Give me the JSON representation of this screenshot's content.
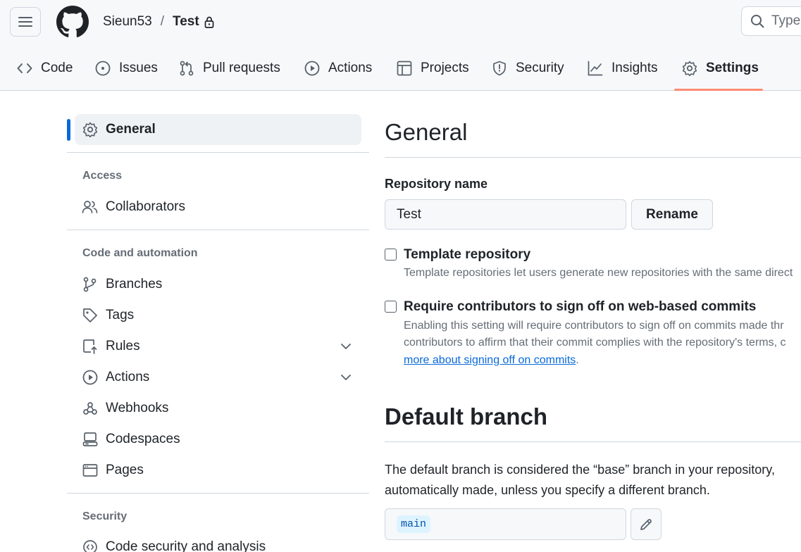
{
  "header": {
    "owner": "Sieun53",
    "separator": "/",
    "repo": "Test",
    "search_placeholder": "Type"
  },
  "tabs": [
    {
      "label": "Code",
      "icon": "code-icon"
    },
    {
      "label": "Issues",
      "icon": "issue-opened-icon"
    },
    {
      "label": "Pull requests",
      "icon": "git-pull-request-icon"
    },
    {
      "label": "Actions",
      "icon": "play-icon"
    },
    {
      "label": "Projects",
      "icon": "table-icon"
    },
    {
      "label": "Security",
      "icon": "shield-icon"
    },
    {
      "label": "Insights",
      "icon": "graph-icon"
    },
    {
      "label": "Settings",
      "icon": "gear-icon",
      "selected": true
    }
  ],
  "sidebar": {
    "general": "General",
    "groups": {
      "access": "Access",
      "code_automation": "Code and automation",
      "security": "Security"
    },
    "items": {
      "collaborators": "Collaborators",
      "branches": "Branches",
      "tags": "Tags",
      "rules": "Rules",
      "actions": "Actions",
      "webhooks": "Webhooks",
      "codespaces": "Codespaces",
      "pages": "Pages",
      "code_security": "Code security and analysis"
    }
  },
  "main": {
    "title": "General",
    "repo_name_label": "Repository name",
    "repo_name_value": "Test",
    "rename_label": "Rename",
    "template": {
      "title": "Template repository",
      "desc": "Template repositories let users generate new repositories with the same direct"
    },
    "signoff": {
      "title": "Require contributors to sign off on web-based commits",
      "desc1": "Enabling this setting will require contributors to sign off on commits made thr",
      "desc2": "contributors to affirm that their commit complies with the repository's terms, c",
      "link": "more about signing off on commits",
      "after_link": "."
    },
    "default_branch": {
      "title": "Default branch",
      "line1": "The default branch is considered the “base” branch in your repository,",
      "line2": "automatically made, unless you specify a different branch.",
      "branch": "main"
    }
  },
  "colors": {
    "accent": "#0969da",
    "tab_underline": "#fd8c73",
    "border": "#d0d7de",
    "muted_text": "#656d76"
  }
}
